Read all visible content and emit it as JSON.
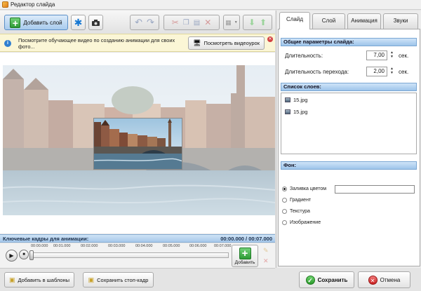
{
  "window": {
    "title": "Редактор слайда"
  },
  "toolbar": {
    "add_layer_label": "Добавить слой"
  },
  "notice": {
    "text": "Посмотрите обучающее видео по созданию анимации для своих фото...",
    "button_label": "Посмотреть видеоурок"
  },
  "keyframes": {
    "title": "Ключевые кадры для анимации:",
    "time": "00:00.000 / 00:07.000",
    "ticks": [
      "00:00.000",
      "00:01.000",
      "00:02.000",
      "00:03.000",
      "00:04.000",
      "00:05.000",
      "00:06.000",
      "00:07.000"
    ],
    "add_label": "Добавить",
    "position_fraction": 0
  },
  "tabs": [
    {
      "label": "Слайд",
      "active": true
    },
    {
      "label": "Слой",
      "active": false
    },
    {
      "label": "Анимация",
      "active": false
    },
    {
      "label": "Звуки",
      "active": false
    }
  ],
  "slide_params": {
    "section_title": "Общие параметры слайда:",
    "duration_label": "Длительность:",
    "duration_value": "7,00",
    "transition_label": "Длительность перехода:",
    "transition_value": "2,00",
    "unit": "сек."
  },
  "layers": {
    "section_title": "Список слоев:",
    "items": [
      "15.jpg",
      "15.jpg"
    ]
  },
  "background": {
    "section_title": "Фон:",
    "options": [
      {
        "label": "Заливка цветом",
        "selected": true
      },
      {
        "label": "Градиент",
        "selected": false
      },
      {
        "label": "Текстура",
        "selected": false
      },
      {
        "label": "Изображение",
        "selected": false
      }
    ]
  },
  "footer": {
    "templates_label": "Добавить в шаблоны",
    "freeze_label": "Сохранить стоп-кадр",
    "save_label": "Сохранить",
    "cancel_label": "Отмена"
  }
}
